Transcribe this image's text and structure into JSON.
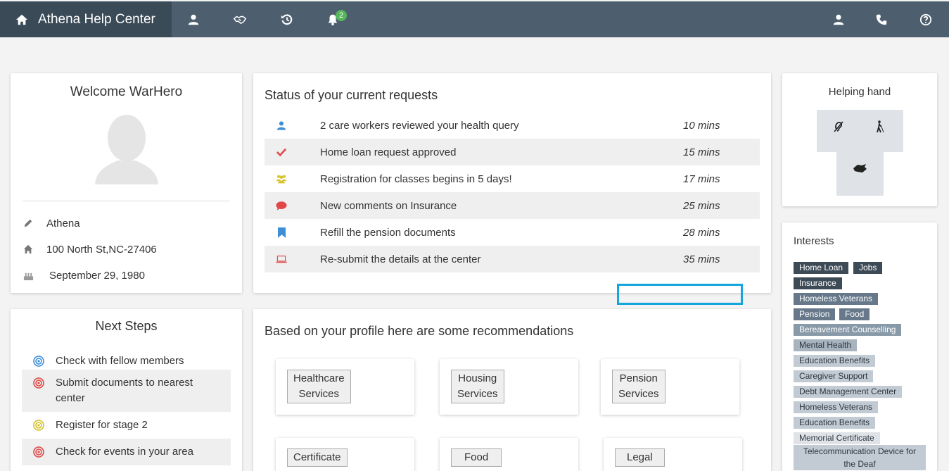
{
  "app": {
    "title": "Athena Help Center"
  },
  "nav": {
    "icons": [
      "home-icon",
      "user-icon",
      "handshake-icon",
      "history-icon",
      "bell-icon"
    ],
    "notification_count": "2",
    "right_icons": [
      "user-icon",
      "phone-icon",
      "help-icon"
    ]
  },
  "welcome": {
    "title": "Welcome WarHero",
    "name": "Athena",
    "address": "100 North St,NC-27406",
    "birthday": "September 29, 1980"
  },
  "next_steps": {
    "title": "Next Steps",
    "items": [
      {
        "label": "Check with fellow members",
        "color": "#3d8fd8"
      },
      {
        "label": "Submit documents to nearest center",
        "color": "#e04848"
      },
      {
        "label": "Register for stage 2",
        "color": "#d1c12a"
      },
      {
        "label": "Check for events in your area",
        "color": "#e04848"
      }
    ]
  },
  "status": {
    "title": "Status of your current requests",
    "rows": [
      {
        "text": "2 care workers reviewed your health query",
        "time": "10 mins",
        "icon": "user-icon",
        "color": "#3d8fd8"
      },
      {
        "text": "Home loan request approved",
        "time": "15 mins",
        "icon": "check-icon",
        "color": "#e04848"
      },
      {
        "text": "Registration for classes begins in 5 days!",
        "time": "17 mins",
        "icon": "group-icon",
        "color": "#d7c22a"
      },
      {
        "text": "New comments on Insurance",
        "time": "25 mins",
        "icon": "comment-icon",
        "color": "#e04848"
      },
      {
        "text": "Refill the pension documents",
        "time": "28 mins",
        "icon": "bookmark-icon",
        "color": "#3d8fd8"
      },
      {
        "text": "Re-submit the details at the center",
        "time": "35 mins",
        "icon": "laptop-icon",
        "color": "#e04848"
      }
    ]
  },
  "recommendations": {
    "title": "Based on your profile here are some recommendations",
    "cards": [
      {
        "line1": "Healthcare",
        "line2": "Services"
      },
      {
        "line1": "Housing",
        "line2": "Services"
      },
      {
        "line1": "Pension",
        "line2": "Services"
      },
      {
        "line1": "Certificate",
        "line2": ""
      },
      {
        "line1": "Food",
        "line2": ""
      },
      {
        "line1": "Legal",
        "line2": ""
      }
    ]
  },
  "helping_hand": {
    "title": "Helping hand",
    "icons": [
      "deaf-icon",
      "blind-icon",
      "sign-language-icon"
    ]
  },
  "interests": {
    "title": "Interests",
    "tags": [
      "Home Loan",
      "Jobs",
      "Insurance",
      "Homeless Veterans",
      "Pension",
      "Food",
      "Bereavement Counselling",
      "Mental Health",
      "Education Benefits",
      "Caregiver Support",
      "Debt Management Center",
      "Homeless Veterans",
      "Education Benefits",
      "Memorial Certificate",
      "Telecommunication Device for the Deaf"
    ]
  }
}
